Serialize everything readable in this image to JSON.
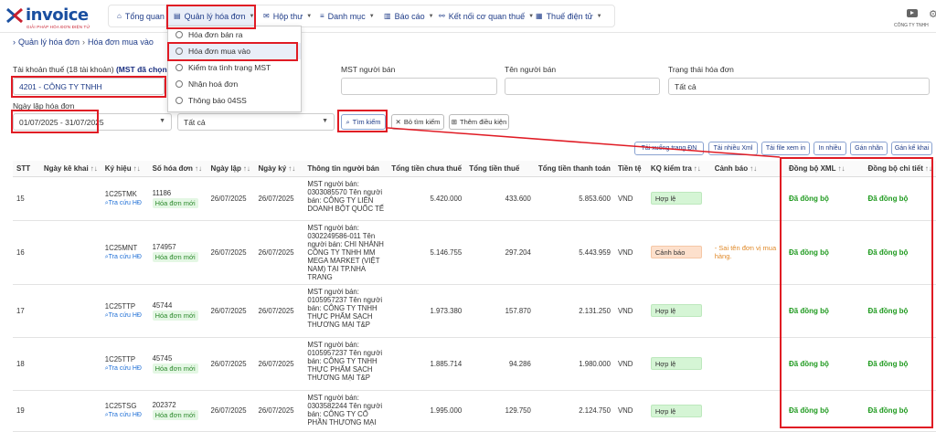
{
  "header": {
    "logo_brand": "invoice",
    "logo_tagline": "GIẢI PHÁP HÓA ĐƠN ĐIỆN TỬ",
    "company_short": "CÔNG TY TNHH",
    "nav": [
      {
        "label": "Tổng quan",
        "icon": "home-icon"
      },
      {
        "label": "Quản lý hóa đơn",
        "icon": "invoice-icon"
      },
      {
        "label": "Hộp thư",
        "icon": "mail-icon"
      },
      {
        "label": "Danh mục",
        "icon": "list-icon"
      },
      {
        "label": "Báo cáo",
        "icon": "chart-icon"
      },
      {
        "label": "Kết nối cơ quan thuế",
        "icon": "connect-icon"
      },
      {
        "label": "Thuế điện tử",
        "icon": "tax-icon"
      }
    ]
  },
  "dropdown": {
    "items": [
      "Hóa đơn bán ra",
      "Hóa đơn mua vào",
      "Kiểm tra tình trạng MST",
      "Nhận hoá đơn",
      "Thông báo 04SS"
    ]
  },
  "breadcrumb": {
    "root": "Quản lý hóa đơn",
    "current": "Hóa đơn mua vào"
  },
  "filters": {
    "tax_account_label": "Tài khoản thuế (18 tài khoản)",
    "tax_account_note": "(MST đã chọn đang",
    "tax_account_value": "4201            - CÔNG TY TNHH",
    "seller_tax_label": "MST người bán",
    "seller_name_label": "Tên người bán",
    "invoice_status_label": "Trạng thái hóa đơn",
    "invoice_status_value": "Tất cả",
    "date_label": "Ngày lập hóa đơn",
    "date_value": "01/07/2025 - 31/07/2025",
    "type_value": "Tất cả",
    "search_btn": "Tìm kiếm",
    "clear_btn": "Bỏ tìm kiếm",
    "more_btn": "Thêm điều kiện"
  },
  "actions": [
    "Tải xuống trang ĐN",
    "Tải nhiều Xml",
    "Tải file xem in",
    "In nhiều",
    "Gán nhãn",
    "Gán kế khai"
  ],
  "table": {
    "columns": [
      "STT",
      "Ngày kê khai",
      "Ký hiệu",
      "Số hóa đơn",
      "Ngày lập",
      "Ngày ký",
      "Thông tin người bán",
      "Tổng tiền chưa thuế",
      "Tổng tiền thuế",
      "Tổng tiền thanh toán",
      "Tiền tệ",
      "KQ kiểm tra",
      "Cảnh báo",
      "Đồng bộ XML",
      "Đồng bộ chi tiết"
    ],
    "lookup_label": "Tra cứu HĐ",
    "new_label": "Hóa đơn mới",
    "rows": [
      {
        "stt": "15",
        "symbol": "1C25TMK",
        "number": "11186",
        "issue_date": "26/07/2025",
        "sign_date": "26/07/2025",
        "seller": "MST người bán: 0303085570 Tên người bán: CÔNG TY LIÊN DOANH BỘT QUỐC TẾ",
        "pre_tax": "5.420.000",
        "tax": "433.600",
        "total": "5.853.600",
        "currency": "VND",
        "check": "Hợp lệ",
        "warning": "",
        "sync_xml": "Đã đồng bộ",
        "sync_detail": "Đã đồng bộ"
      },
      {
        "stt": "16",
        "symbol": "1C25MNT",
        "number": "174957",
        "issue_date": "26/07/2025",
        "sign_date": "26/07/2025",
        "seller": "MST người bán: 0302249586-011 Tên người bán: CHI NHÁNH CÔNG TY TNHH MM MEGA MARKET (VIỆT NAM) TẠI TP.NHA TRANG",
        "pre_tax": "5.146.755",
        "tax": "297.204",
        "total": "5.443.959",
        "currency": "VND",
        "check": "Cảnh báo",
        "warning": "- Sai tên đơn vị mua hàng.",
        "sync_xml": "Đã đồng bộ",
        "sync_detail": "Đã đồng bộ"
      },
      {
        "stt": "17",
        "symbol": "1C25TTP",
        "number": "45744",
        "issue_date": "26/07/2025",
        "sign_date": "26/07/2025",
        "seller": "MST người bán: 0105957237 Tên người bán: CÔNG TY TNHH THỰC PHẨM SẠCH THƯƠNG MẠI T&P",
        "pre_tax": "1.973.380",
        "tax": "157.870",
        "total": "2.131.250",
        "currency": "VND",
        "check": "Hợp lệ",
        "warning": "",
        "sync_xml": "Đã đồng bộ",
        "sync_detail": "Đã đồng bộ"
      },
      {
        "stt": "18",
        "symbol": "1C25TTP",
        "number": "45745",
        "issue_date": "26/07/2025",
        "sign_date": "26/07/2025",
        "seller": "MST người bán: 0105957237 Tên người bán: CÔNG TY TNHH THỰC PHẨM SẠCH THƯƠNG MẠI T&P",
        "pre_tax": "1.885.714",
        "tax": "94.286",
        "total": "1.980.000",
        "currency": "VND",
        "check": "Hợp lệ",
        "warning": "",
        "sync_xml": "Đã đồng bộ",
        "sync_detail": "Đã đồng bộ"
      },
      {
        "stt": "19",
        "symbol": "1C25TSG",
        "number": "202372",
        "issue_date": "26/07/2025",
        "sign_date": "26/07/2025",
        "seller": "MST người bán: 0303582244 Tên người bán: CÔNG TY CỔ PHẦN THƯƠNG MẠI",
        "pre_tax": "1.995.000",
        "tax": "129.750",
        "total": "2.124.750",
        "currency": "VND",
        "check": "Hợp lệ",
        "warning": "",
        "sync_xml": "Đã đồng bộ",
        "sync_detail": "Đã đồng bộ"
      }
    ]
  },
  "colors": {
    "accent": "#1f3c88",
    "highlight": "#e01b24",
    "success": "#1f9a1f",
    "warning": "#e08a2a"
  }
}
